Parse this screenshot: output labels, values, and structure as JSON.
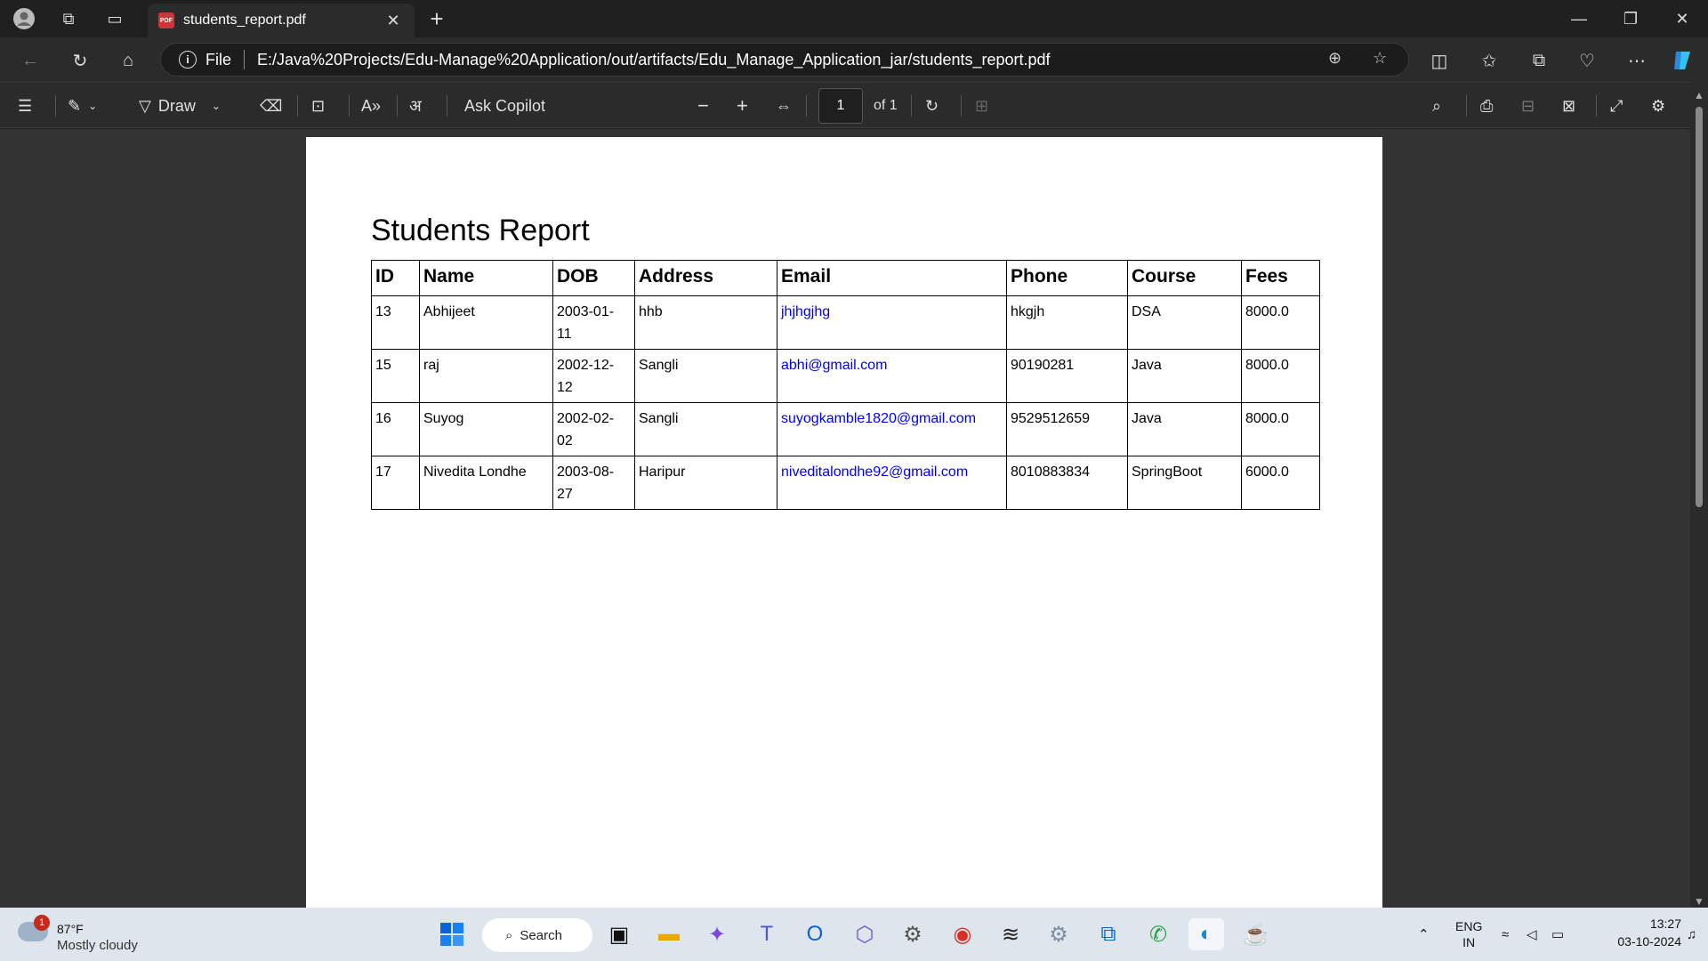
{
  "browser": {
    "tab_title": "students_report.pdf",
    "tab_close": "✕",
    "new_tab": "+",
    "address_scheme": "File",
    "address_url": "E:/Java%20Projects/Edu-Manage%20Application/out/artifacts/Edu_Manage_Application_jar/students_report.pdf"
  },
  "pdf_toolbar": {
    "draw_label": "Draw",
    "ask_copilot_label": "Ask Copilot",
    "page_current": "1",
    "page_total": "of 1"
  },
  "document": {
    "title": "Students Report",
    "columns": [
      "ID",
      "Name",
      "DOB",
      "Address",
      "Email",
      "Phone",
      "Course",
      "Fees"
    ],
    "rows": [
      {
        "id": "13",
        "name": "Abhijeet",
        "dob_l1": "2003-01-",
        "dob_l2": "11",
        "address": "hhb",
        "email": "jhjhgjhg",
        "phone": "hkgjh",
        "course": "DSA",
        "fees": "8000.0"
      },
      {
        "id": "15",
        "name": "raj",
        "dob_l1": "2002-12-",
        "dob_l2": "12",
        "address": "Sangli",
        "email": "abhi@gmail.com",
        "phone": "90190281",
        "course": "Java",
        "fees": "8000.0"
      },
      {
        "id": "16",
        "name": "Suyog",
        "dob_l1": "2002-02-",
        "dob_l2": "02",
        "address": "Sangli",
        "email": "suyogkamble1820@gmail.com",
        "phone": "9529512659",
        "course": "Java",
        "fees": "8000.0"
      },
      {
        "id": "17",
        "name": "Nivedita Londhe",
        "dob_l1": "2003-08-",
        "dob_l2": "27",
        "address": "Haripur",
        "email": "niveditalondhe92@gmail.com",
        "phone": "8010883834",
        "course": "SpringBoot",
        "fees": "6000.0"
      }
    ]
  },
  "taskbar": {
    "weather_badge": "1",
    "weather_temp": "87°F",
    "weather_condition": "Mostly cloudy",
    "search_label": "Search",
    "language_l1": "ENG",
    "language_l2": "IN",
    "time": "13:27",
    "date": "03-10-2024"
  },
  "colors": {
    "link": "#0000ee",
    "chrome_bg": "#202020",
    "toolbar_bg": "#2b2b2b",
    "viewer_bg": "#333333"
  }
}
